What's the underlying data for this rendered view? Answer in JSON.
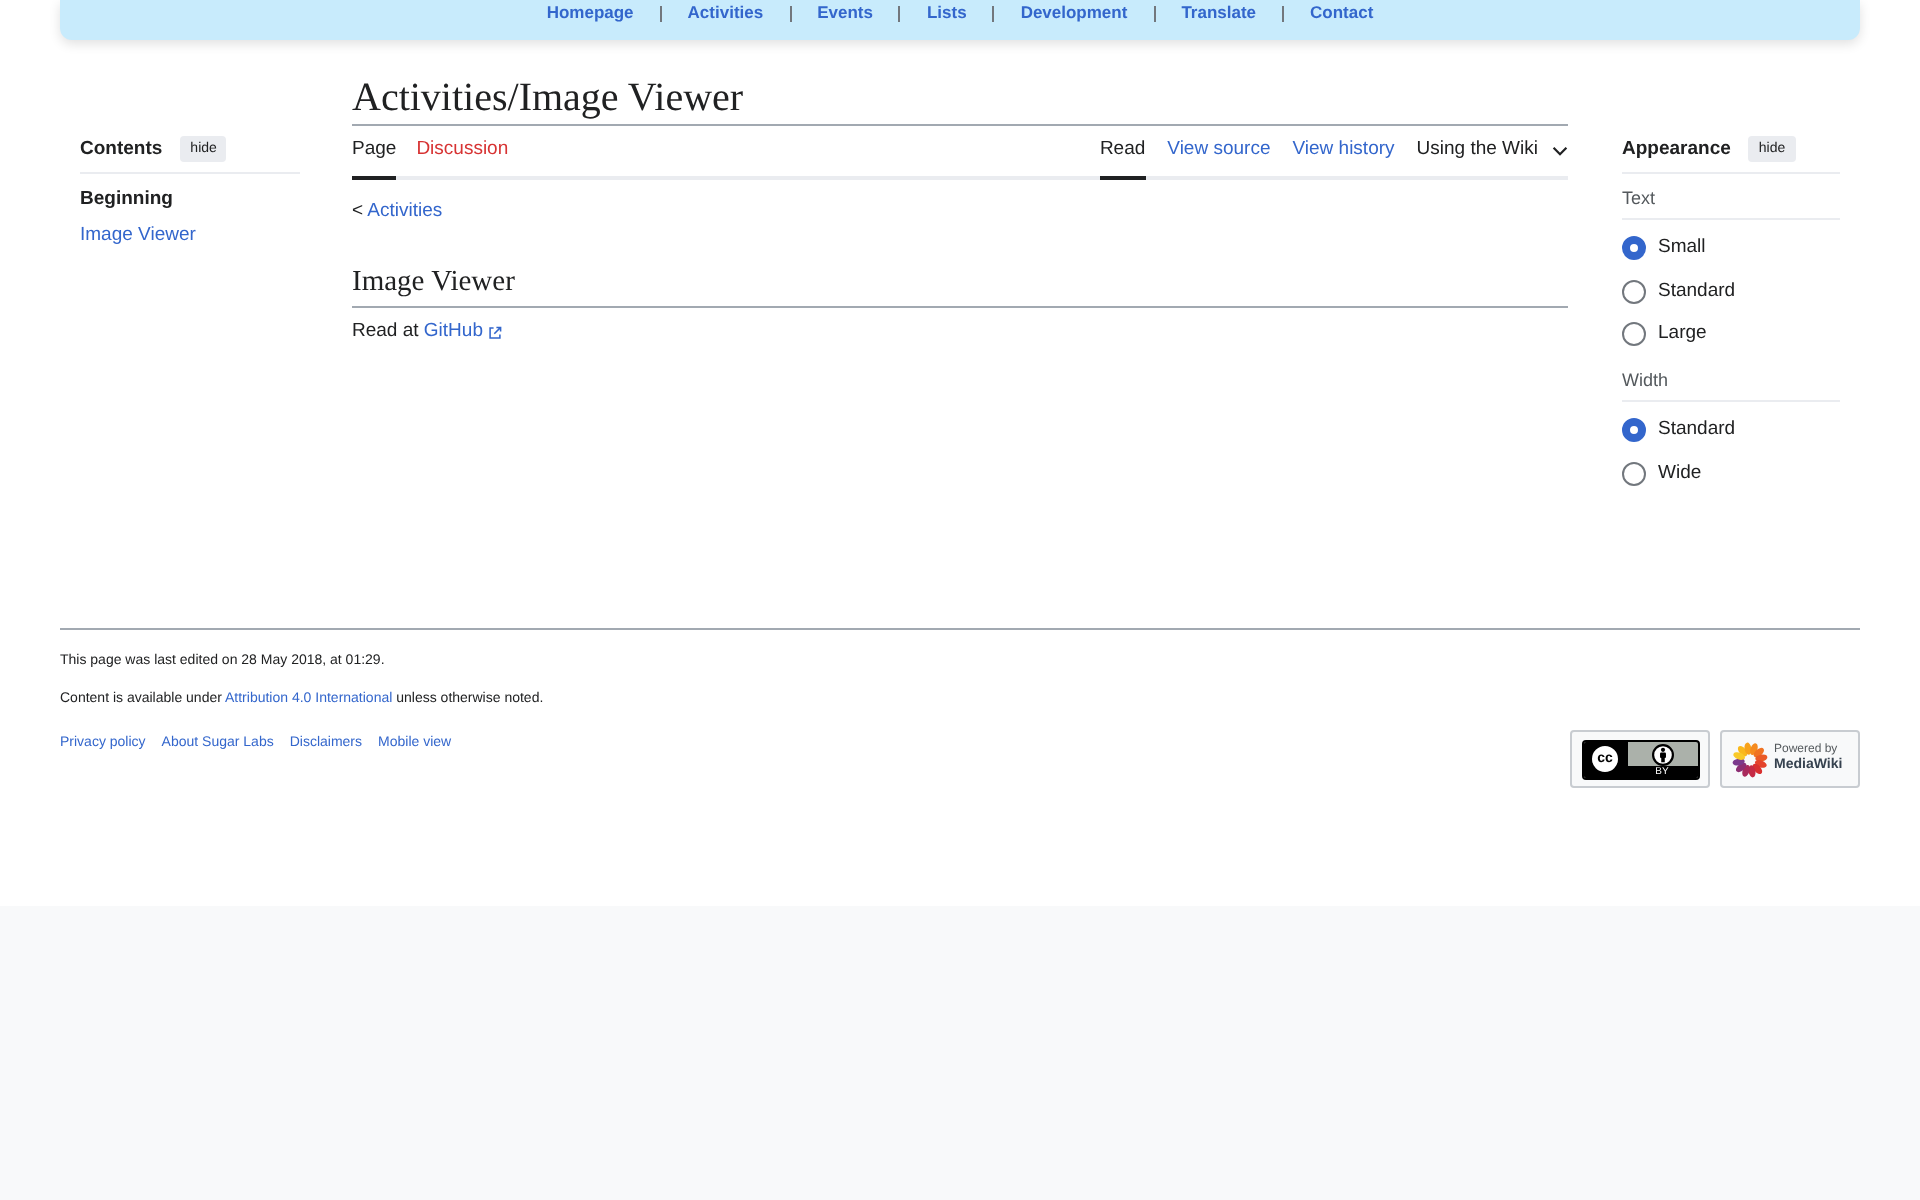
{
  "top_nav": {
    "links": [
      "Homepage",
      "Activities",
      "Events",
      "Lists",
      "Development",
      "Translate",
      "Contact"
    ]
  },
  "toc": {
    "title": "Contents",
    "hide_button": "hide",
    "items": [
      {
        "label": "Beginning",
        "selected": true
      },
      {
        "label": "Image Viewer",
        "selected": false
      }
    ]
  },
  "page": {
    "title": "Activities/Image Viewer",
    "left_tabs": [
      {
        "label": "Page",
        "selected": true,
        "missing": false
      },
      {
        "label": "Discussion",
        "selected": false,
        "missing": true
      }
    ],
    "right_tabs": [
      {
        "kind": "tab",
        "label": "Read",
        "selected": true
      },
      {
        "kind": "tab",
        "label": "View source",
        "selected": false
      },
      {
        "kind": "tab",
        "label": "View history",
        "selected": false
      },
      {
        "kind": "dropdown",
        "label": "Using the Wiki",
        "selected": false
      }
    ],
    "breadcrumb": {
      "text": "<",
      "link": "Activities"
    },
    "sections": [
      {
        "heading": "Image Viewer",
        "text": "Read at",
        "link": "GitHub",
        "external": true
      }
    ]
  },
  "appearance": {
    "title": "Appearance",
    "hide_button": "hide",
    "groups": [
      {
        "label": "Text",
        "options": [
          {
            "label": "Small",
            "selected": true
          },
          {
            "label": "Standard",
            "selected": false
          },
          {
            "label": "Large",
            "selected": false
          }
        ]
      },
      {
        "label": "Width",
        "options": [
          {
            "label": "Standard",
            "selected": true
          },
          {
            "label": "Wide",
            "selected": false
          }
        ]
      }
    ]
  },
  "footer": {
    "last_edited": "This page was last edited on 28 May 2018, at 01:29.",
    "license": {
      "before": "Content is available under",
      "link": "Attribution 4.0 International",
      "after": "unless otherwise noted."
    },
    "links": [
      "Privacy policy",
      "About Sugar Labs",
      "Disclaimers",
      "Mobile view"
    ],
    "badges": [
      {
        "kind": "cc-by",
        "logo": "cc",
        "label": "BY"
      },
      {
        "kind": "mediawiki",
        "caption": [
          "Powered by",
          "MediaWiki"
        ]
      }
    ]
  }
}
